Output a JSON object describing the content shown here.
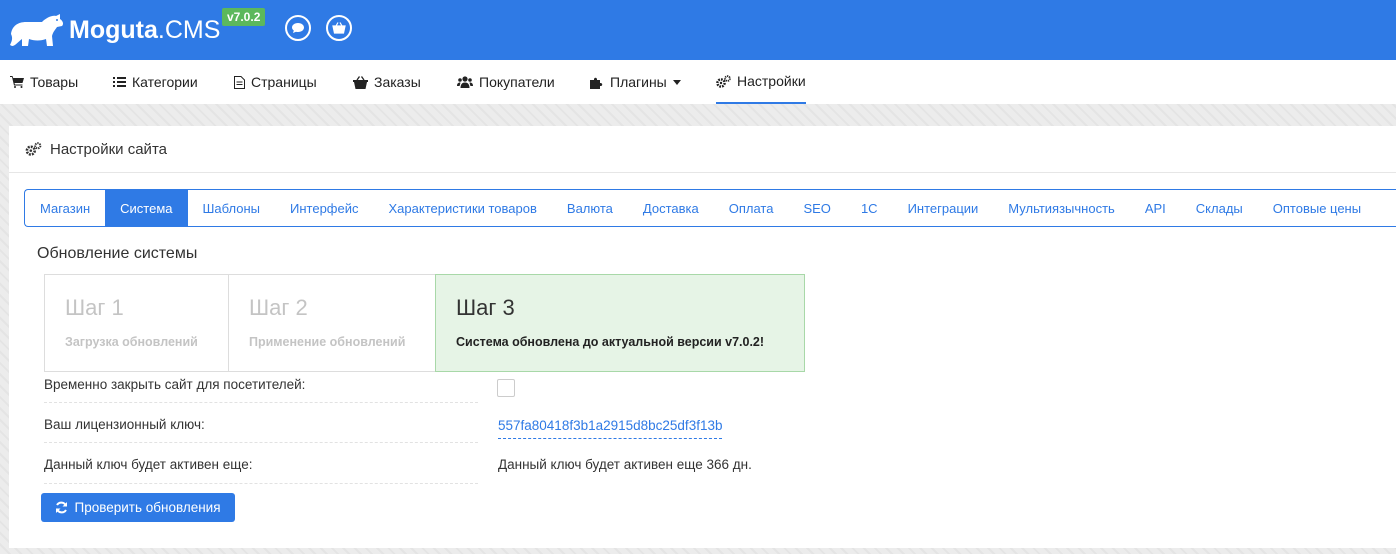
{
  "header": {
    "brand_bold": "Moguta",
    "brand_light": ".CMS",
    "version": "v7.0.2",
    "color": "#2f7ae5"
  },
  "nav": [
    {
      "label": "Товары",
      "icon": "cart-icon"
    },
    {
      "label": "Категории",
      "icon": "list-icon"
    },
    {
      "label": "Страницы",
      "icon": "page-icon"
    },
    {
      "label": "Заказы",
      "icon": "basket-icon"
    },
    {
      "label": "Покупатели",
      "icon": "users-icon"
    },
    {
      "label": "Плагины",
      "icon": "puzzle-icon"
    },
    {
      "label": "Настройки",
      "icon": "gears-icon",
      "active": true
    }
  ],
  "panel": {
    "title": "Настройки сайта"
  },
  "tabs": [
    {
      "label": "Магазин"
    },
    {
      "label": "Система",
      "active": true
    },
    {
      "label": "Шаблоны"
    },
    {
      "label": "Интерфейс"
    },
    {
      "label": "Характеристики товаров"
    },
    {
      "label": "Валюта"
    },
    {
      "label": "Доставка"
    },
    {
      "label": "Оплата"
    },
    {
      "label": "SEO"
    },
    {
      "label": "1С"
    },
    {
      "label": "Интеграции"
    },
    {
      "label": "Мультиязычность"
    },
    {
      "label": "API"
    },
    {
      "label": "Склады"
    },
    {
      "label": "Оптовые цены"
    }
  ],
  "update": {
    "title": "Обновление системы",
    "steps": [
      {
        "num": "Шаг 1",
        "desc": "Загрузка обновлений"
      },
      {
        "num": "Шаг 2",
        "desc": "Применение обновлений"
      },
      {
        "num": "Шаг 3",
        "desc": "Система обновлена до актуальной версии v7.0.2!"
      }
    ]
  },
  "settings": {
    "close_site_label": "Временно закрыть сайт для посетителей:",
    "close_site_checked": false,
    "license_label": "Ваш лицензионный ключ:",
    "license_key": "557fa80418f3b1a2915d8bc25df3f13b",
    "key_active_label": "Данный ключ будет активен еще:",
    "key_active_value": "Данный ключ будет активен еще 366 дн."
  },
  "check_button": "Проверить обновления"
}
